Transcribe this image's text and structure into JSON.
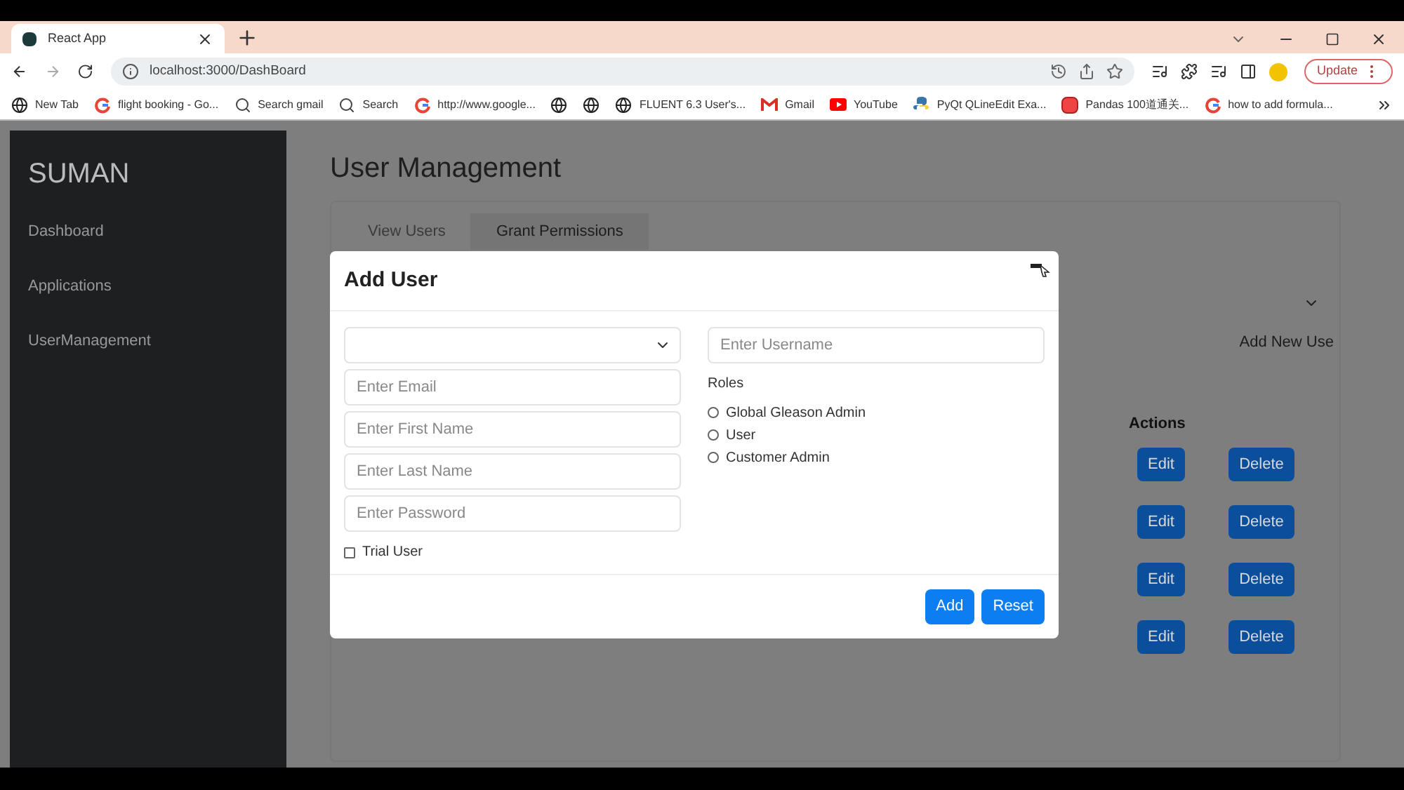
{
  "browser": {
    "tab": {
      "title": "React App"
    },
    "url": "localhost:3000/DashBoard",
    "update_button": "Update",
    "bookmarks": [
      {
        "kind": "globe",
        "label": "New Tab"
      },
      {
        "kind": "google",
        "label": "flight booking - Go..."
      },
      {
        "kind": "search",
        "label": "Search gmail"
      },
      {
        "kind": "search",
        "label": "Search"
      },
      {
        "kind": "google",
        "label": "http://www.google..."
      },
      {
        "kind": "globe"
      },
      {
        "kind": "globe"
      },
      {
        "kind": "globe",
        "label": "FLUENT 6.3 User's..."
      },
      {
        "kind": "gmail",
        "label": "Gmail"
      },
      {
        "kind": "youtube",
        "label": "YouTube"
      },
      {
        "kind": "python",
        "label": "PyQt QLineEdit Exa..."
      },
      {
        "kind": "pandas",
        "label": "Pandas 100道通关..."
      },
      {
        "kind": "google",
        "label": "how to add formula..."
      }
    ]
  },
  "sidebar": {
    "brand": "SUMAN",
    "items": [
      "Dashboard",
      "Applications",
      "UserManagement"
    ]
  },
  "page": {
    "title": "User Management",
    "tabs": [
      {
        "label": "View Users",
        "selected": false
      },
      {
        "label": "Grant Permissions",
        "selected": true
      }
    ],
    "add_new_user": "Add New Use",
    "table": {
      "header": "Actions",
      "rows": [
        {
          "edit": "Edit",
          "delete": "Delete"
        },
        {
          "edit": "Edit",
          "delete": "Delete"
        },
        {
          "edit": "Edit",
          "delete": "Delete"
        },
        {
          "edit": "Edit",
          "delete": "Delete"
        }
      ]
    }
  },
  "modal": {
    "title": "Add User",
    "left_fields": [
      {
        "placeholder": "Enter Email"
      },
      {
        "placeholder": "Enter First Name"
      },
      {
        "placeholder": "Enter Last Name"
      },
      {
        "placeholder": "Enter Password"
      }
    ],
    "trial_user": {
      "label": "Trial User",
      "checked": false
    },
    "username": {
      "placeholder": "Enter Username"
    },
    "roles_label": "Roles",
    "roles": [
      {
        "label": "Global Gleason Admin",
        "selected": false
      },
      {
        "label": "User",
        "selected": false
      },
      {
        "label": "Customer Admin",
        "selected": false
      }
    ],
    "buttons": [
      "Add",
      "Reset"
    ]
  }
}
